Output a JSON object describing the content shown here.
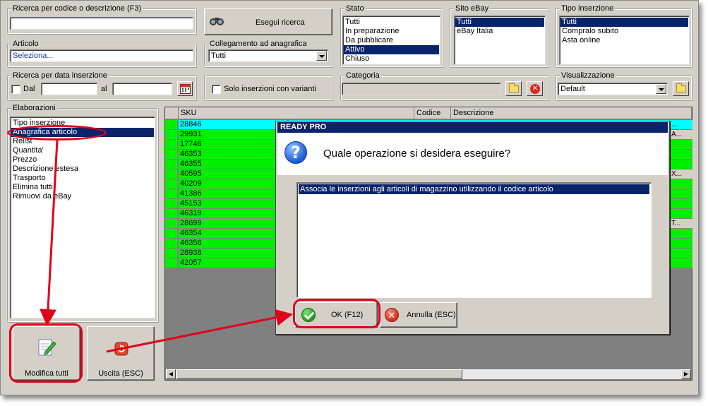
{
  "search": {
    "label": "Ricerca per codice o descrizione (F3)",
    "value": "",
    "button": "Esegui ricerca"
  },
  "articolo": {
    "label": "Articolo",
    "value": "Seleziona..."
  },
  "collegamento": {
    "label": "Collegamento ad anagrafica",
    "value": "Tutti"
  },
  "stato": {
    "label": "Stato",
    "items": [
      "Tutti",
      "In preparazione",
      "Da pubblicare",
      "Attivo",
      "Chiuso"
    ],
    "selected": "Attivo"
  },
  "sito": {
    "label": "Sito eBay",
    "items": [
      "Tutti",
      "eBay Italia"
    ],
    "selected": "Tutti"
  },
  "tipo": {
    "label": "Tipo inserzione",
    "items": [
      "Tutti",
      "Compralo subito",
      "Asta online"
    ],
    "selected": "Tutti"
  },
  "data": {
    "label": "Ricerca per data inserzione",
    "dal": "Dal",
    "al": "al"
  },
  "varianti": {
    "label": "Solo inserzioni con varianti"
  },
  "categoria": {
    "label": "Categoria"
  },
  "visualizzazione": {
    "label": "Visualizzazione",
    "value": "Default"
  },
  "elaborazioni": {
    "label": "Elaborazioni",
    "items": [
      "Tipo inserzione",
      "Anagrafica articolo",
      "Relist",
      "Quantita'",
      "Prezzo",
      "Descrizione estesa",
      "Trasporto",
      "Elimina tutti",
      "Rimuovi da eBay"
    ],
    "selected": "Anagrafica articolo"
  },
  "buttons": {
    "modifica": "Modifica tutti",
    "uscita": "Uscita (ESC)"
  },
  "grid": {
    "headers": {
      "sku": "SKU",
      "codice": "Codice",
      "descrizione": "Descrizione"
    },
    "rows": [
      {
        "sku": "28846",
        "tail": "..."
      },
      {
        "sku": "29931",
        "tail": "A..."
      },
      {
        "sku": "17746",
        "tail": ""
      },
      {
        "sku": "46353",
        "tail": ""
      },
      {
        "sku": "46355",
        "tail": ""
      },
      {
        "sku": "40595",
        "tail": "X..."
      },
      {
        "sku": "40209",
        "tail": ""
      },
      {
        "sku": "41386",
        "tail": ""
      },
      {
        "sku": "45153",
        "tail": ""
      },
      {
        "sku": "46319",
        "tail": ""
      },
      {
        "sku": "28699",
        "tail": "T..."
      },
      {
        "sku": "46354",
        "tail": ""
      },
      {
        "sku": "46356",
        "tail": ""
      },
      {
        "sku": "28938",
        "tail": ""
      },
      {
        "sku": "42057",
        "tail": ""
      }
    ]
  },
  "dialog": {
    "title": "READY PRO",
    "question": "Quale operazione si desidera eseguire?",
    "option": "Associa le inserzioni agli articoli di magazzino utilizzando il codice articolo",
    "ok": "OK (F12)",
    "annulla": "Annulla (ESC)"
  },
  "colors": {
    "selection": "#0a246a",
    "row_green": "#00f000",
    "annotation_red": "#e0001a"
  }
}
